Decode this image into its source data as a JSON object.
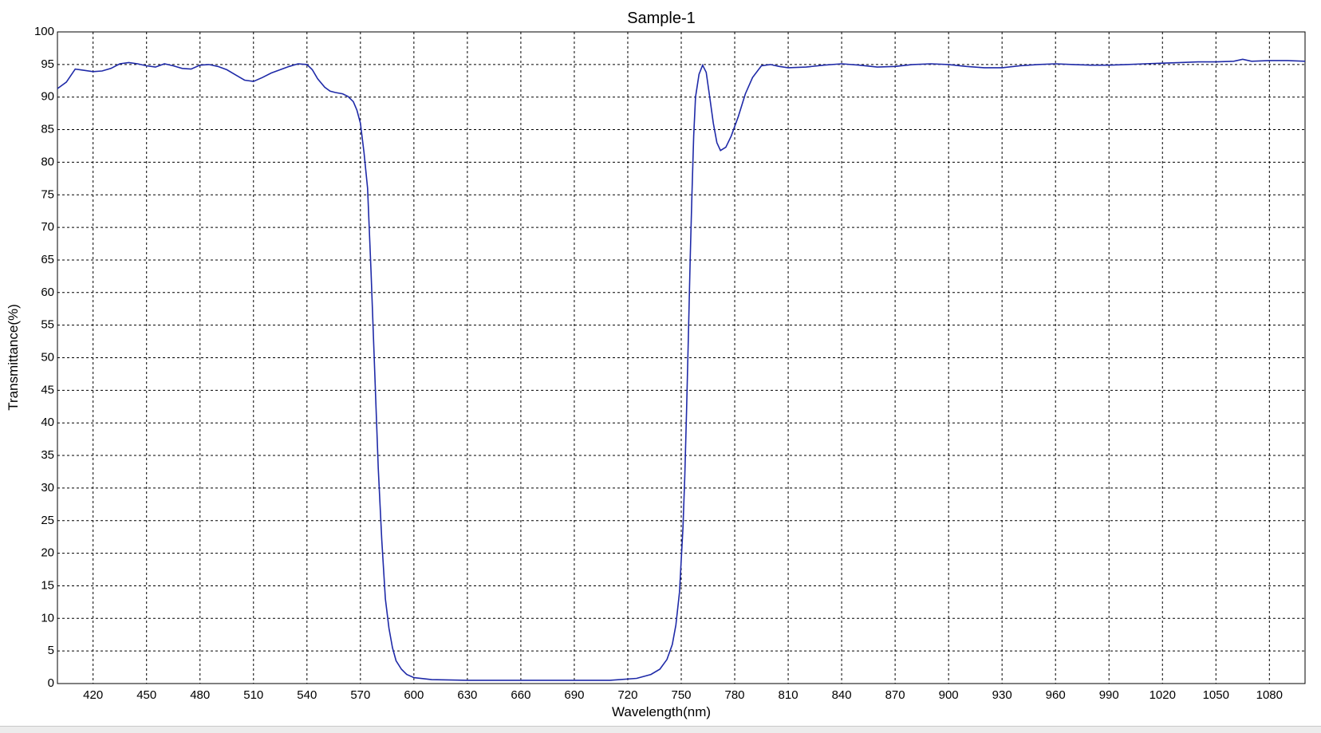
{
  "chart_data": {
    "type": "line",
    "title": "Sample-1",
    "xlabel": "Wavelength(nm)",
    "ylabel": "Transmittance(%)",
    "xlim": [
      400,
      1100
    ],
    "ylim": [
      0,
      100
    ],
    "x_ticks": [
      420,
      450,
      480,
      510,
      540,
      570,
      600,
      630,
      660,
      690,
      720,
      750,
      780,
      810,
      840,
      870,
      900,
      930,
      960,
      990,
      1020,
      1050,
      1080
    ],
    "y_ticks": [
      0,
      5,
      10,
      15,
      20,
      25,
      30,
      35,
      40,
      45,
      50,
      55,
      60,
      65,
      70,
      75,
      80,
      85,
      90,
      95,
      100
    ],
    "grid": true,
    "line_color": "#1f2aa8",
    "series": [
      {
        "points": [
          [
            400,
            91.3
          ],
          [
            405,
            92.3
          ],
          [
            410,
            94.3
          ],
          [
            415,
            94.1
          ],
          [
            420,
            93.9
          ],
          [
            425,
            94.0
          ],
          [
            430,
            94.4
          ],
          [
            435,
            95.1
          ],
          [
            440,
            95.3
          ],
          [
            445,
            95.1
          ],
          [
            450,
            94.8
          ],
          [
            455,
            94.6
          ],
          [
            460,
            95.1
          ],
          [
            465,
            94.8
          ],
          [
            470,
            94.4
          ],
          [
            475,
            94.3
          ],
          [
            480,
            94.9
          ],
          [
            485,
            95.0
          ],
          [
            490,
            94.7
          ],
          [
            495,
            94.2
          ],
          [
            500,
            93.4
          ],
          [
            505,
            92.6
          ],
          [
            510,
            92.4
          ],
          [
            515,
            93.0
          ],
          [
            520,
            93.7
          ],
          [
            525,
            94.2
          ],
          [
            530,
            94.7
          ],
          [
            535,
            95.1
          ],
          [
            540,
            95.0
          ],
          [
            543,
            94.2
          ],
          [
            546,
            92.8
          ],
          [
            550,
            91.5
          ],
          [
            553,
            90.9
          ],
          [
            556,
            90.7
          ],
          [
            560,
            90.5
          ],
          [
            563,
            90.1
          ],
          [
            566,
            89.3
          ],
          [
            568,
            88.0
          ],
          [
            570,
            86.0
          ],
          [
            572,
            81.5
          ],
          [
            574,
            76.0
          ],
          [
            576,
            63.0
          ],
          [
            578,
            48.0
          ],
          [
            580,
            33.0
          ],
          [
            582,
            22.0
          ],
          [
            584,
            13.0
          ],
          [
            586,
            8.5
          ],
          [
            588,
            5.5
          ],
          [
            590,
            3.5
          ],
          [
            593,
            2.2
          ],
          [
            596,
            1.4
          ],
          [
            600,
            0.9
          ],
          [
            610,
            0.6
          ],
          [
            630,
            0.5
          ],
          [
            660,
            0.5
          ],
          [
            690,
            0.5
          ],
          [
            710,
            0.5
          ],
          [
            725,
            0.8
          ],
          [
            733,
            1.4
          ],
          [
            738,
            2.2
          ],
          [
            742,
            3.7
          ],
          [
            745,
            6.0
          ],
          [
            747,
            9.0
          ],
          [
            749,
            14.0
          ],
          [
            751,
            24.0
          ],
          [
            752,
            32.0
          ],
          [
            753,
            42.0
          ],
          [
            754,
            53.0
          ],
          [
            755,
            65.0
          ],
          [
            756,
            75.0
          ],
          [
            757,
            84.0
          ],
          [
            758,
            90.0
          ],
          [
            760,
            93.5
          ],
          [
            762,
            94.9
          ],
          [
            764,
            93.8
          ],
          [
            766,
            90.0
          ],
          [
            768,
            86.0
          ],
          [
            770,
            83.0
          ],
          [
            772,
            81.8
          ],
          [
            775,
            82.3
          ],
          [
            778,
            84.0
          ],
          [
            782,
            87.0
          ],
          [
            786,
            90.5
          ],
          [
            790,
            93.0
          ],
          [
            795,
            94.8
          ],
          [
            800,
            95.0
          ],
          [
            805,
            94.7
          ],
          [
            810,
            94.5
          ],
          [
            820,
            94.6
          ],
          [
            830,
            94.9
          ],
          [
            840,
            95.1
          ],
          [
            850,
            94.9
          ],
          [
            860,
            94.6
          ],
          [
            870,
            94.7
          ],
          [
            880,
            95.0
          ],
          [
            890,
            95.1
          ],
          [
            900,
            95.0
          ],
          [
            910,
            94.7
          ],
          [
            920,
            94.5
          ],
          [
            930,
            94.5
          ],
          [
            940,
            94.8
          ],
          [
            950,
            95.0
          ],
          [
            960,
            95.1
          ],
          [
            970,
            95.0
          ],
          [
            980,
            94.9
          ],
          [
            990,
            94.9
          ],
          [
            1000,
            95.0
          ],
          [
            1010,
            95.1
          ],
          [
            1020,
            95.2
          ],
          [
            1030,
            95.3
          ],
          [
            1040,
            95.4
          ],
          [
            1050,
            95.4
          ],
          [
            1060,
            95.5
          ],
          [
            1065,
            95.8
          ],
          [
            1070,
            95.5
          ],
          [
            1080,
            95.6
          ],
          [
            1090,
            95.6
          ],
          [
            1100,
            95.5
          ]
        ]
      }
    ]
  }
}
